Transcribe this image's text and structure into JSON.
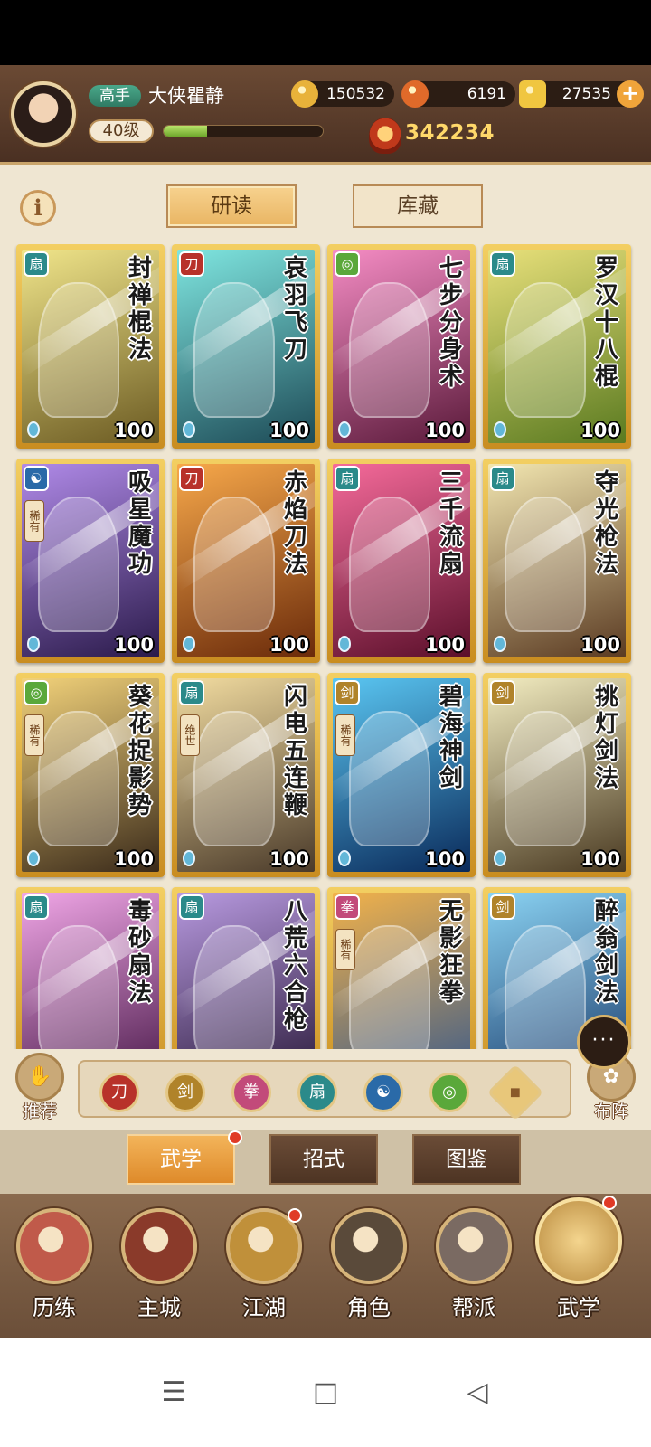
{
  "player": {
    "rank": "高手",
    "name": "大侠瞿静",
    "level": "40级",
    "exp_fraction": 0.27,
    "power": "342234"
  },
  "resources": [
    {
      "name": "coin",
      "icon": "coin-icon",
      "value": "150532",
      "color": "#e8b23a"
    },
    {
      "name": "flame-token",
      "icon": "flame-token-icon",
      "value": "6191",
      "color": "#e06a2a"
    },
    {
      "name": "gold-ingot",
      "icon": "gold-ingot-icon",
      "value": "27535",
      "color": "#f0c640"
    }
  ],
  "top_tabs": {
    "read": "研读",
    "store": "库藏",
    "info": "i"
  },
  "cards": [
    {
      "name": "封禅棍法",
      "level": "100",
      "type": "fan",
      "type_color": "#2b8a8a",
      "bg": [
        "#f0e58a",
        "#6b5a22"
      ],
      "rarity": ""
    },
    {
      "name": "哀羽飞刀",
      "level": "100",
      "type": "blade",
      "type_color": "#b8322a",
      "bg": [
        "#7fe6e0",
        "#1d4a56"
      ],
      "rarity": ""
    },
    {
      "name": "七步分身术",
      "level": "100",
      "type": "swirl",
      "type_color": "#5aa83a",
      "bg": [
        "#f58cc4",
        "#5a1a3a"
      ],
      "rarity": ""
    },
    {
      "name": "罗汉十八棍",
      "level": "100",
      "type": "fan",
      "type_color": "#2b8a8a",
      "bg": [
        "#e8e07a",
        "#5a7a20"
      ],
      "rarity": ""
    },
    {
      "name": "吸星魔功",
      "level": "100",
      "type": "yinyang",
      "type_color": "#2a6aa8",
      "bg": [
        "#b08ae8",
        "#2a1a4a"
      ],
      "rarity": "稀有"
    },
    {
      "name": "赤焰刀法",
      "level": "100",
      "type": "blade",
      "type_color": "#b8322a",
      "bg": [
        "#f7a84a",
        "#6a2a0a"
      ],
      "rarity": ""
    },
    {
      "name": "三千流扇",
      "level": "100",
      "type": "fan",
      "type_color": "#2b8a8a",
      "bg": [
        "#f56a9a",
        "#5a0f2a"
      ],
      "rarity": ""
    },
    {
      "name": "夺光枪法",
      "level": "100",
      "type": "fan",
      "type_color": "#2b8a8a",
      "bg": [
        "#f2e6b0",
        "#5a3a22"
      ],
      "rarity": ""
    },
    {
      "name": "葵花捉影势",
      "level": "100",
      "type": "swirl",
      "type_color": "#5aa83a",
      "bg": [
        "#f2d27a",
        "#3a2a1a"
      ],
      "rarity": "稀有"
    },
    {
      "name": "闪电五连鞭",
      "level": "100",
      "type": "fan",
      "type_color": "#2b8a8a",
      "bg": [
        "#f2dca0",
        "#4a3a2a"
      ],
      "rarity": "绝世"
    },
    {
      "name": "碧海神剑",
      "level": "100",
      "type": "sword",
      "type_color": "#b0832a",
      "bg": [
        "#5ac6f2",
        "#0a2a5a"
      ],
      "rarity": "稀有"
    },
    {
      "name": "挑灯剑法",
      "level": "100",
      "type": "sword",
      "type_color": "#b0832a",
      "bg": [
        "#f2ecc0",
        "#4a3a22"
      ],
      "rarity": ""
    },
    {
      "name": "毒砂扇法",
      "level": "",
      "type": "fan",
      "type_color": "#2b8a8a",
      "bg": [
        "#f0a6e6",
        "#4a1a4a"
      ],
      "rarity": ""
    },
    {
      "name": "八荒六合枪",
      "level": "",
      "type": "fan",
      "type_color": "#2b8a8a",
      "bg": [
        "#b89ae0",
        "#2a1a3a"
      ],
      "rarity": ""
    },
    {
      "name": "无影狂拳",
      "level": "",
      "type": "fist",
      "type_color": "#c24a7a",
      "bg": [
        "#f2b24a",
        "#3a5a8a"
      ],
      "rarity": "稀有"
    },
    {
      "name": "醉翁剑法",
      "level": "",
      "type": "sword",
      "type_color": "#b0832a",
      "bg": [
        "#8ad2f2",
        "#1a3a6a"
      ],
      "rarity": ""
    }
  ],
  "filter_bar": {
    "recommend": "推荐",
    "formation": "布阵",
    "chat": "···",
    "icons": [
      {
        "icon": "blade-filter-icon",
        "color": "#b8322a",
        "glyph": "刀"
      },
      {
        "icon": "sword-filter-icon",
        "color": "#b0832a",
        "glyph": "剑"
      },
      {
        "icon": "fist-filter-icon",
        "color": "#c24a7a",
        "glyph": "拳"
      },
      {
        "icon": "fan-filter-icon",
        "color": "#2b8a8a",
        "glyph": "扇"
      },
      {
        "icon": "yinyang-filter-icon",
        "color": "#2a6aa8",
        "glyph": "☯"
      },
      {
        "icon": "swirl-filter-icon",
        "color": "#5aa83a",
        "glyph": "◎"
      },
      {
        "icon": "diamond-filter-icon",
        "color": "#e8c77a",
        "glyph": "◆"
      }
    ]
  },
  "sub_tabs": [
    "武学",
    "招式",
    "图鉴"
  ],
  "nav": [
    {
      "label": "历练",
      "icon": "training-icon",
      "color": "#c05a4a"
    },
    {
      "label": "主城",
      "icon": "city-icon",
      "color": "#8a3a2a"
    },
    {
      "label": "江湖",
      "icon": "jianghu-icon",
      "color": "#c0903a"
    },
    {
      "label": "角色",
      "icon": "character-icon",
      "color": "#5a4a3a"
    },
    {
      "label": "帮派",
      "icon": "guild-icon",
      "color": "#7a6a62"
    },
    {
      "label": "武学",
      "icon": "martial-arts-icon",
      "color": "#b98a3e"
    }
  ],
  "system_nav": {
    "menu": "☰",
    "home": "□",
    "back": "◁"
  }
}
